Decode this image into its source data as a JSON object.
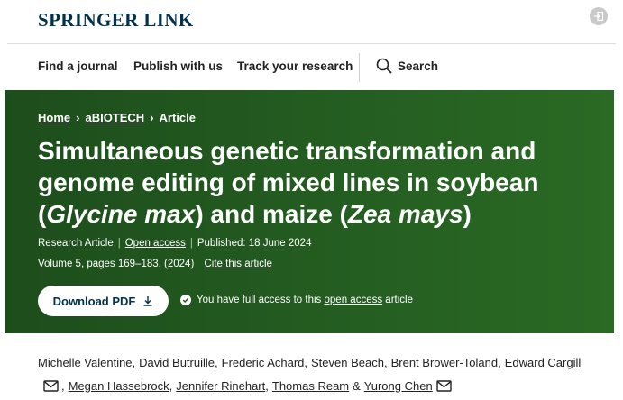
{
  "brand": {
    "logo_text": "SPRINGER LINK",
    "color": "#01324b"
  },
  "header_icons": {
    "login": "login-icon"
  },
  "nav": {
    "items": [
      "Find a journal",
      "Publish with us",
      "Track your research"
    ],
    "search_label": "Search"
  },
  "breadcrumb": {
    "home": "Home",
    "journal": "aBIOTECH",
    "current": "Article"
  },
  "article": {
    "title_part1": "Simultaneous genetic transformation and genome editing of mixed lines in soybean (",
    "title_italic1": "Glycine max",
    "title_part2": ") and maize (",
    "title_italic2": "Zea mays",
    "title_part3": ")",
    "type": "Research Article",
    "open_access": "Open access",
    "published": "Published: 18 June 2024",
    "volume": "Volume 5, pages 169–183, (2024)",
    "cite": "Cite this article",
    "download_label": "Download PDF",
    "access_text_before": "You have full access to this",
    "access_link": "open access",
    "access_text_after": "article",
    "hero_color": "#235a20"
  },
  "authors": {
    "line1": [
      "Michelle Valentine",
      "David Butruille",
      "Frederic Achard",
      "Steven Beach",
      "Brent Brower-Toland",
      "Edward Cargill"
    ],
    "line2": [
      "Megan Hassebrock",
      "Jennifer Rinehart",
      "Thomas Ream",
      "Yurong Chen"
    ],
    "conjunction": "&"
  }
}
